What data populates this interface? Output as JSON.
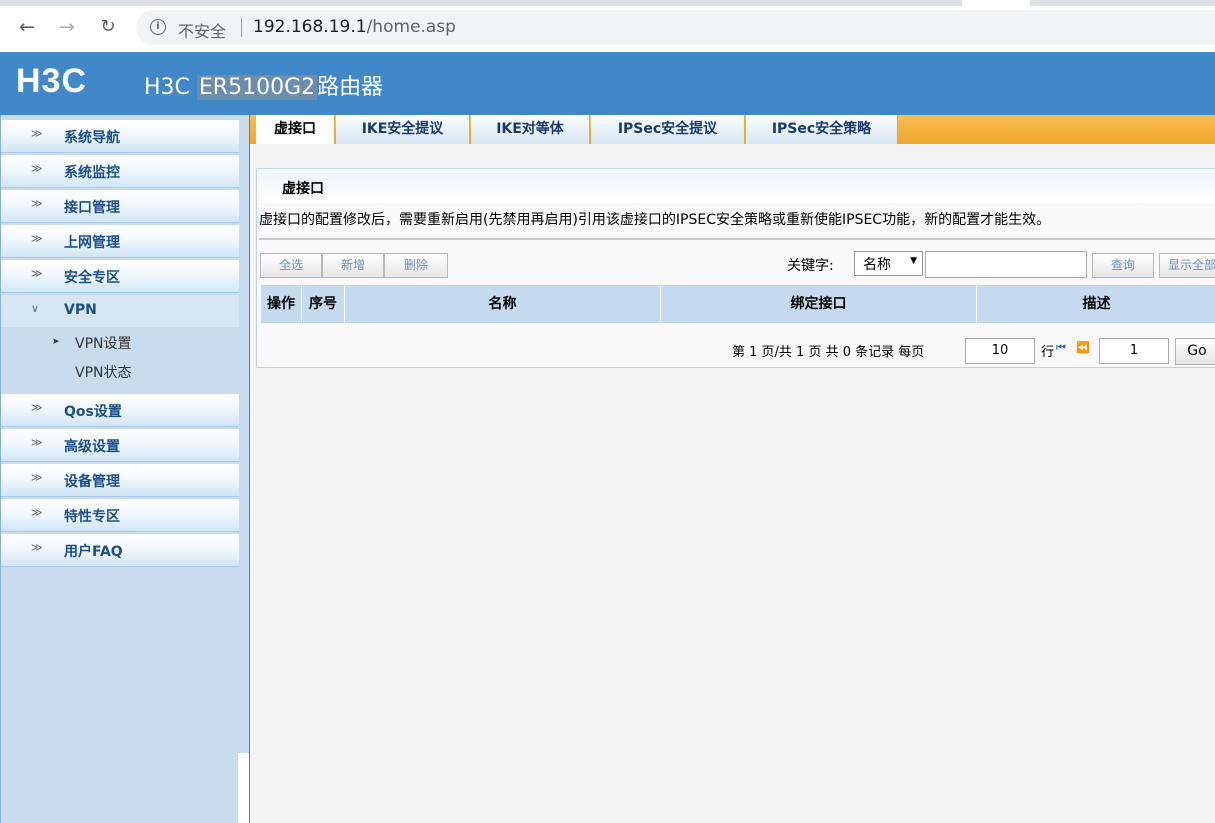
{
  "browser": {
    "security_label": "不安全",
    "url_host": "192.168.19.1",
    "url_path": "/home.asp"
  },
  "banner": {
    "logo": "H3C",
    "product_prefix": "H3C",
    "model": "ER5100G2",
    "product_suffix": "路由器"
  },
  "sidebar": {
    "items": [
      {
        "label": "系统导航"
      },
      {
        "label": "系统监控"
      },
      {
        "label": "接口管理"
      },
      {
        "label": "上网管理"
      },
      {
        "label": "安全专区"
      },
      {
        "label": "VPN"
      },
      {
        "label": "Qos设置"
      },
      {
        "label": "高级设置"
      },
      {
        "label": "设备管理"
      },
      {
        "label": "特性专区"
      },
      {
        "label": "用户FAQ"
      }
    ],
    "vpn_sub": [
      {
        "label": "VPN设置"
      },
      {
        "label": "VPN状态"
      }
    ]
  },
  "tabs": [
    {
      "label": "虚接口"
    },
    {
      "label": "IKE安全提议"
    },
    {
      "label": "IKE对等体"
    },
    {
      "label": "IPSec安全提议"
    },
    {
      "label": "IPSec安全策略"
    }
  ],
  "panel": {
    "title": "虚接口",
    "notice": "虚接口的配置修改后，需要重新启用(先禁用再启用)引用该虚接口的IPSEC安全策略或重新使能IPSEC功能，新的配置才能生效。",
    "buttons": {
      "select_all": "全选",
      "add": "新增",
      "delete": "删除"
    },
    "keyword_label": "关键字:",
    "keyword_field": "名称",
    "query": "查询",
    "show_all": "显示全部",
    "table_headers": [
      "操作",
      "序号",
      "名称",
      "绑定接口",
      "描述"
    ],
    "pager": {
      "text": "第 1 页/共 1 页 共 0 条记录 每页",
      "per_page": "10",
      "rows_label": "行",
      "page": "1",
      "go": "Go"
    }
  },
  "colors": {
    "banner": "#4088c8",
    "sidebar": "#c9dced",
    "tabbar": "#f3a52c",
    "table_header": "#c5daef"
  }
}
